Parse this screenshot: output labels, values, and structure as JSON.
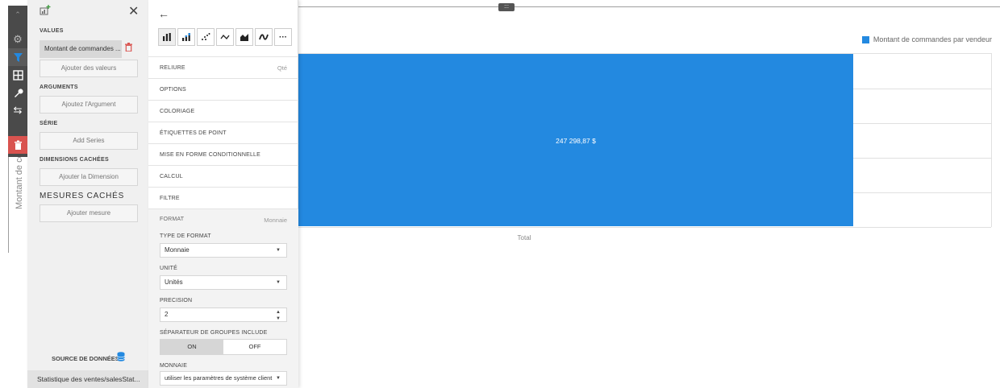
{
  "chart": {
    "legend_label": "Montant de commandes par vendeur",
    "legend_color": "#2389e0",
    "bar_label": "247 298,87 $",
    "x_tick": "Total",
    "y_axis_title": "Montant de co",
    "drag_handle": ":::"
  },
  "chart_data": {
    "type": "bar",
    "categories": [
      "Total"
    ],
    "series": [
      {
        "name": "Montant de commandes par vendeur",
        "values": [
          247298.87
        ]
      }
    ],
    "xlabel": "",
    "ylabel": "Montant de co"
  },
  "iconbar": {
    "collapse": "^",
    "icons": [
      "collapse-icon",
      "gear-icon",
      "filter-icon",
      "layout-icon",
      "wrench-icon",
      "arrows-icon",
      "trash-icon"
    ]
  },
  "bindings": {
    "values_label": "VALUES",
    "value_item": "Montant de commandes ...",
    "add_values": "Ajouter des valeurs",
    "arguments_label": "ARGUMENTS",
    "add_argument": "Ajoutez l'Argument",
    "series_label": "SÉRIE",
    "add_series": "Add Series",
    "hidden_dims_label": "DIMENSIONS CACHÉES",
    "add_dimension": "Ajouter la Dimension",
    "hidden_measures_label": "MESURES CACHÉS",
    "add_measure": "Ajouter mesure",
    "datasource_label": "SOURCE DE DONNÉES",
    "datasource_value": "Statistique des ventes/salesStat..."
  },
  "options": {
    "chart_types": [
      "bar-chart-icon",
      "stacked-bar-icon",
      "scatter-icon",
      "line-icon",
      "area-icon",
      "spline-icon",
      "more-icon"
    ],
    "rows": [
      {
        "label": "RELIURE",
        "value": "Qté"
      },
      {
        "label": "OPTIONS",
        "value": ""
      },
      {
        "label": "COLORIAGE",
        "value": ""
      },
      {
        "label": "ÉTIQUETTES DE POINT",
        "value": ""
      },
      {
        "label": "MISE EN FORME CONDITIONNELLE",
        "value": ""
      },
      {
        "label": "CALCUL",
        "value": ""
      },
      {
        "label": "FILTRE",
        "value": ""
      }
    ],
    "format": {
      "label": "FORMAT",
      "value": "Monnaie",
      "format_type_label": "TYPE DE FORMAT",
      "format_type_value": "Monnaie",
      "unit_label": "UNITÉ",
      "unit_value": "Unités",
      "precision_label": "PRECISION",
      "precision_value": "2",
      "separator_label": "SÉPARATEUR DE GROUPES INCLUDE",
      "toggle_on": "ON",
      "toggle_off": "OFF",
      "currency_label": "MONNAIE",
      "currency_value": "utiliser les paramètres de système client"
    }
  }
}
